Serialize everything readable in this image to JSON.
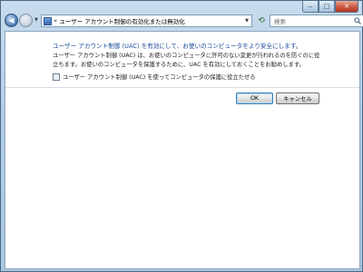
{
  "window": {
    "caption_buttons": {
      "minimize": "‒",
      "maximize": "□",
      "close": "✕"
    }
  },
  "address_bar": {
    "back_icon": "back-arrow-icon",
    "forward_icon": "forward-arrow-icon",
    "path_prefix": "«",
    "path": "ユーザー アカウント制御の有効化または無効化"
  },
  "search": {
    "placeholder": "検索"
  },
  "main": {
    "heading": "ユーザー アカウント制御 (UAC) を有効にして、お使いのコンピュータをより安全にします。",
    "description": "ユーザー アカウント制御 (UAC) は、お使いのコンピュータに許可のない変更が行われるのを防ぐのに役立ちます。お使いのコンピュータを保護するために、UAC を有効にしておくことをお勧めします。",
    "checkbox": {
      "label": "ユーザー アカウント制御 (UAC) を使ってコンピュータの保護に役立たせる",
      "checked": false
    }
  },
  "buttons": {
    "ok": "OK",
    "cancel": "キャンセル"
  },
  "colors": {
    "heading_text": "#1e4e9c",
    "window_frame": "#a9c5e0",
    "close_button": "#cf5d46"
  }
}
